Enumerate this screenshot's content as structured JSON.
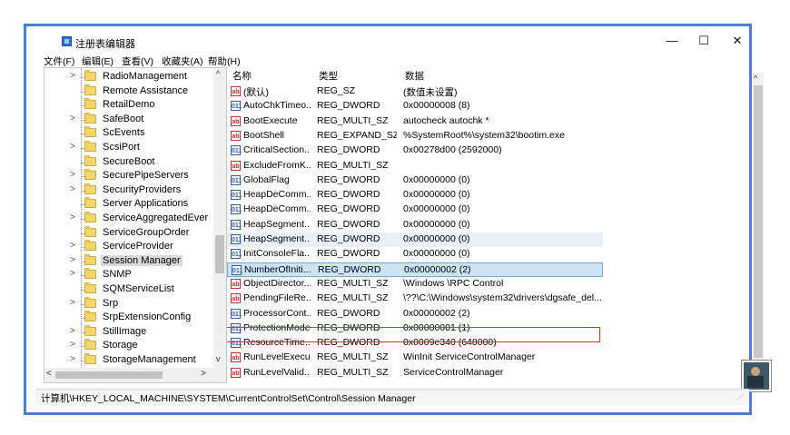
{
  "window": {
    "title": "注册表编辑器",
    "minimize_glyph": "—",
    "maximize_glyph": "☐",
    "close_glyph": "✕"
  },
  "menu": {
    "items": [
      "文件(F)",
      "编辑(E)",
      "查看(V)",
      "收藏夹(A)",
      "帮助(H)"
    ]
  },
  "tree": {
    "items": [
      {
        "label": "RadioManagement",
        "expander": ">"
      },
      {
        "label": "Remote Assistance",
        "expander": ""
      },
      {
        "label": "RetailDemo",
        "expander": ""
      },
      {
        "label": "SafeBoot",
        "expander": ">"
      },
      {
        "label": "ScEvents",
        "expander": ""
      },
      {
        "label": "ScsiPort",
        "expander": ">"
      },
      {
        "label": "SecureBoot",
        "expander": ""
      },
      {
        "label": "SecurePipeServers",
        "expander": ">"
      },
      {
        "label": "SecurityProviders",
        "expander": ">"
      },
      {
        "label": "Server Applications",
        "expander": ""
      },
      {
        "label": "ServiceAggregatedEver",
        "expander": ">"
      },
      {
        "label": "ServiceGroupOrder",
        "expander": ""
      },
      {
        "label": "ServiceProvider",
        "expander": ">"
      },
      {
        "label": "Session Manager",
        "expander": ">"
      },
      {
        "label": "SNMP",
        "expander": ">"
      },
      {
        "label": "SQMServiceList",
        "expander": ""
      },
      {
        "label": "Srp",
        "expander": ">"
      },
      {
        "label": "SrpExtensionConfig",
        "expander": ""
      },
      {
        "label": "StillImage",
        "expander": ">"
      },
      {
        "label": "Storage",
        "expander": ">"
      },
      {
        "label": "StorageManagement",
        "expander": ">"
      }
    ],
    "selected": "Session Manager",
    "scroll_up": "^",
    "scroll_down": "v",
    "scroll_left": "<",
    "scroll_right": ">"
  },
  "list": {
    "headers": {
      "name": "名称",
      "type": "类型",
      "data": "数据"
    },
    "rows": [
      {
        "icon": "string-value-icon",
        "name": "(默认)",
        "type": "REG_SZ",
        "data": "(数值未设置)"
      },
      {
        "icon": "binary-value-icon",
        "name": "AutoChkTimeo...",
        "type": "REG_DWORD",
        "data": "0x00000008 (8)"
      },
      {
        "icon": "string-value-icon",
        "name": "BootExecute",
        "type": "REG_MULTI_SZ",
        "data": "autocheck autochk *"
      },
      {
        "icon": "string-value-icon",
        "name": "BootShell",
        "type": "REG_EXPAND_SZ",
        "data": "%SystemRoot%\\system32\\bootim.exe"
      },
      {
        "icon": "binary-value-icon",
        "name": "CriticalSection...",
        "type": "REG_DWORD",
        "data": "0x00278d00 (2592000)"
      },
      {
        "icon": "string-value-icon",
        "name": "ExcludeFromK...",
        "type": "REG_MULTI_SZ",
        "data": ""
      },
      {
        "icon": "binary-value-icon",
        "name": "GlobalFlag",
        "type": "REG_DWORD",
        "data": "0x00000000 (0)"
      },
      {
        "icon": "binary-value-icon",
        "name": "HeapDeComm...",
        "type": "REG_DWORD",
        "data": "0x00000000 (0)"
      },
      {
        "icon": "binary-value-icon",
        "name": "HeapDeComm...",
        "type": "REG_DWORD",
        "data": "0x00000000 (0)"
      },
      {
        "icon": "binary-value-icon",
        "name": "HeapSegment...",
        "type": "REG_DWORD",
        "data": "0x00000000 (0)"
      },
      {
        "icon": "binary-value-icon",
        "name": "HeapSegment...",
        "type": "REG_DWORD",
        "data": "0x00000000 (0)"
      },
      {
        "icon": "binary-value-icon",
        "name": "InitConsoleFla...",
        "type": "REG_DWORD",
        "data": "0x00000000 (0)"
      },
      {
        "icon": "binary-value-icon",
        "name": "NumberOfIniti...",
        "type": "REG_DWORD",
        "data": "0x00000002 (2)"
      },
      {
        "icon": "string-value-icon",
        "name": "ObjectDirector...",
        "type": "REG_MULTI_SZ",
        "data": "\\Windows \\RPC Control"
      },
      {
        "icon": "string-value-icon",
        "name": "PendingFileRe...",
        "type": "REG_MULTI_SZ",
        "data": "\\??\\C:\\Windows\\system32\\drivers\\dgsafe_del..."
      },
      {
        "icon": "binary-value-icon",
        "name": "ProcessorCont...",
        "type": "REG_DWORD",
        "data": "0x00000002 (2)"
      },
      {
        "icon": "binary-value-icon",
        "name": "ProtectionMode",
        "type": "REG_DWORD",
        "data": "0x00000001 (1)"
      },
      {
        "icon": "binary-value-icon",
        "name": "ResourceTime...",
        "type": "REG_DWORD",
        "data": "0x0009e340 (648000)"
      },
      {
        "icon": "string-value-icon",
        "name": "RunLevelExecu...",
        "type": "REG_MULTI_SZ",
        "data": "WinInit ServiceControlManager"
      },
      {
        "icon": "string-value-icon",
        "name": "RunLevelValid...",
        "type": "REG_MULTI_SZ",
        "data": "ServiceControlManager"
      }
    ],
    "icon_glyphs": {
      "string": "ab",
      "binary": "011"
    },
    "scroll_up": "^"
  },
  "statusbar": {
    "path": "计算机\\HKEY_LOCAL_MACHINE\\SYSTEM\\CurrentControlSet\\Control\\Session Manager"
  },
  "colors": {
    "frame_border": "#4d7ed6",
    "highlight_box": "#e03030",
    "selected_row": "#cce4f7"
  }
}
